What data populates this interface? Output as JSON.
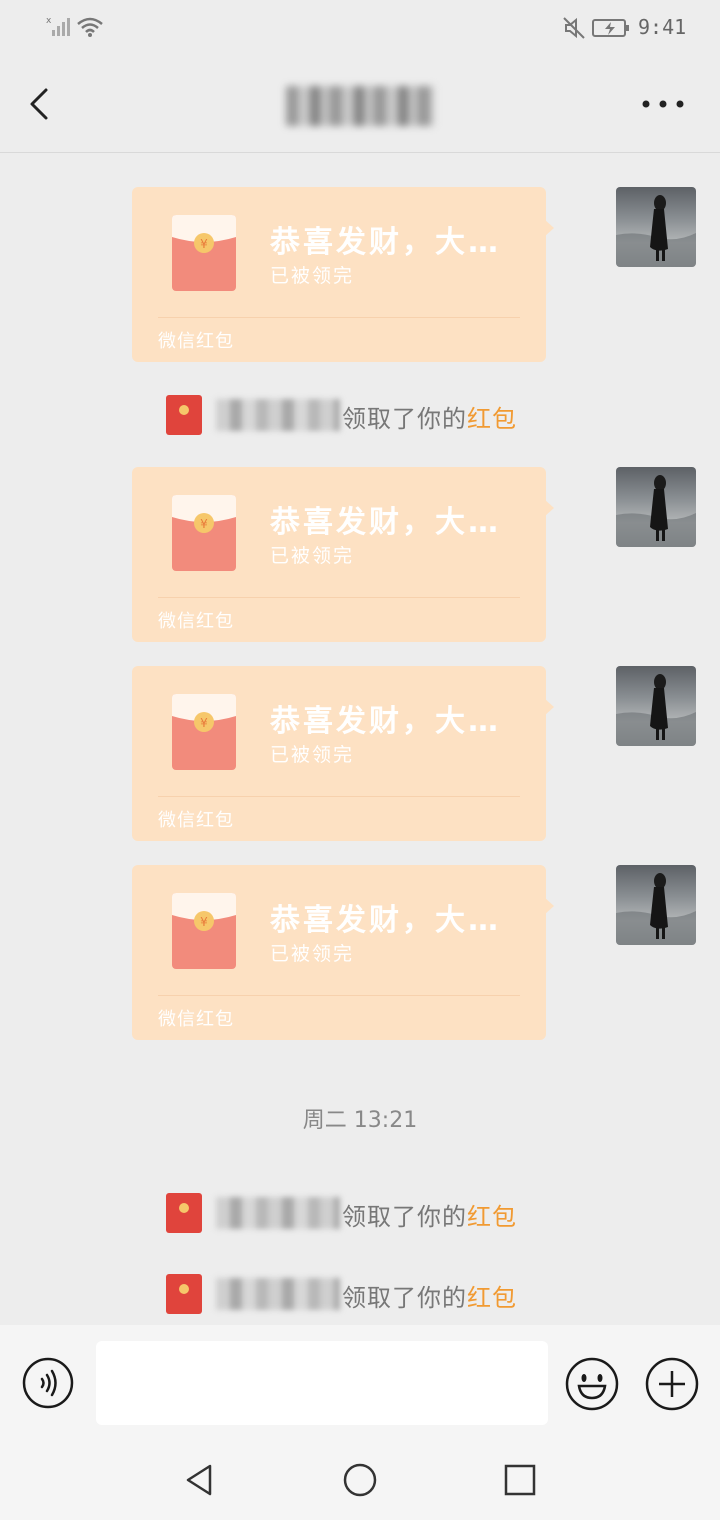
{
  "status_bar": {
    "time": "9:41",
    "icons": [
      "signal-icon",
      "wifi-icon",
      "mute-icon",
      "battery-charging-icon"
    ]
  },
  "nav": {
    "title": "",
    "back_icon": "chevron-left-icon",
    "more_icon": "more-icon"
  },
  "red_packets": [
    {
      "title": "恭喜发财，大…",
      "status": "已被领完",
      "footer": "微信红包"
    },
    {
      "title": "恭喜发财，大…",
      "status": "已被领完",
      "footer": "微信红包"
    },
    {
      "title": "恭喜发财，大…",
      "status": "已被领完",
      "footer": "微信红包"
    },
    {
      "title": "恭喜发财，大…",
      "status": "已被领完",
      "footer": "微信红包"
    }
  ],
  "system_messages": [
    {
      "text": "领取了你的",
      "link": "红包"
    },
    {
      "text": "领取了你的",
      "link": "红包"
    },
    {
      "text": "领取了你的",
      "link": "红包"
    }
  ],
  "time_divider": "周二 13:21",
  "input_bar": {
    "placeholder": "",
    "voice_icon": "voice-icon",
    "emoji_icon": "emoji-icon",
    "plus_icon": "plus-icon"
  },
  "system_nav": [
    "back-triangle-icon",
    "home-circle-icon",
    "recent-square-icon"
  ],
  "colors": {
    "background": "#ededed",
    "red_packet": "#fde1c3",
    "envelope": "#f28b7c",
    "link": "#f19a32"
  }
}
